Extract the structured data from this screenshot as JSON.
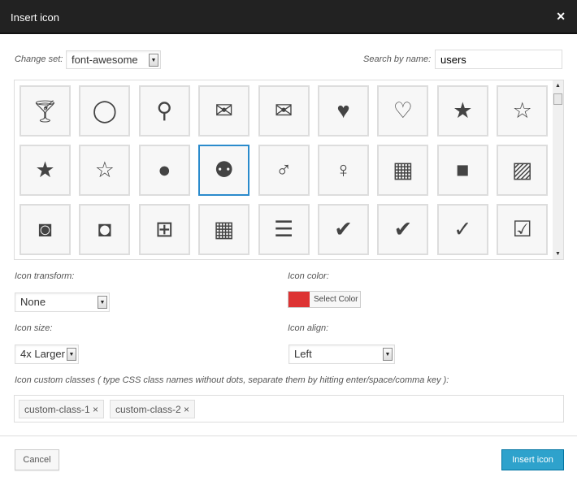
{
  "dialog": {
    "title": "Insert icon",
    "close": "✕"
  },
  "change_set": {
    "label": "Change set:",
    "value": "font-awesome"
  },
  "search": {
    "label": "Search by name:",
    "value": "users"
  },
  "icons": [
    {
      "name": "glass",
      "glyph": "🍸︎"
    },
    {
      "name": "lemon",
      "glyph": "◯"
    },
    {
      "name": "search",
      "glyph": "⚲"
    },
    {
      "name": "envelope-o",
      "glyph": "✉"
    },
    {
      "name": "envelope",
      "glyph": "✉"
    },
    {
      "name": "heart",
      "glyph": "♥"
    },
    {
      "name": "heart-o",
      "glyph": "♡"
    },
    {
      "name": "star",
      "glyph": "★"
    },
    {
      "name": "star-o",
      "glyph": "☆"
    },
    {
      "name": "star-half",
      "glyph": "★"
    },
    {
      "name": "star-half-o",
      "glyph": "☆"
    },
    {
      "name": "user",
      "glyph": "●"
    },
    {
      "name": "users",
      "glyph": "⚉",
      "selected": true
    },
    {
      "name": "male",
      "glyph": "♂"
    },
    {
      "name": "female",
      "glyph": "♀"
    },
    {
      "name": "film",
      "glyph": "▦"
    },
    {
      "name": "video-camera",
      "glyph": "■"
    },
    {
      "name": "picture-o",
      "glyph": "▨"
    },
    {
      "name": "camera",
      "glyph": "◙"
    },
    {
      "name": "camera-retro",
      "glyph": "◘"
    },
    {
      "name": "th-large",
      "glyph": "⊞"
    },
    {
      "name": "th",
      "glyph": "▦"
    },
    {
      "name": "th-list",
      "glyph": "☰"
    },
    {
      "name": "check",
      "glyph": "✔"
    },
    {
      "name": "check-circle",
      "glyph": "✔"
    },
    {
      "name": "check-circle-o",
      "glyph": "✓"
    },
    {
      "name": "check-square",
      "glyph": "☑"
    }
  ],
  "transform": {
    "label": "Icon transform:",
    "value": "None"
  },
  "color": {
    "label": "Icon color:",
    "button": "Select Color",
    "value": "#dd3333"
  },
  "size": {
    "label": "Icon size:",
    "value": "4x Larger"
  },
  "align": {
    "label": "Icon align:",
    "value": "Left"
  },
  "custom": {
    "label": "Icon custom classes ( type CSS class names without dots, separate them by hitting enter/space/comma key ):",
    "tags": [
      "custom-class-1 ×",
      "custom-class-2 ×"
    ]
  },
  "footer": {
    "cancel": "Cancel",
    "insert": "Insert icon"
  }
}
